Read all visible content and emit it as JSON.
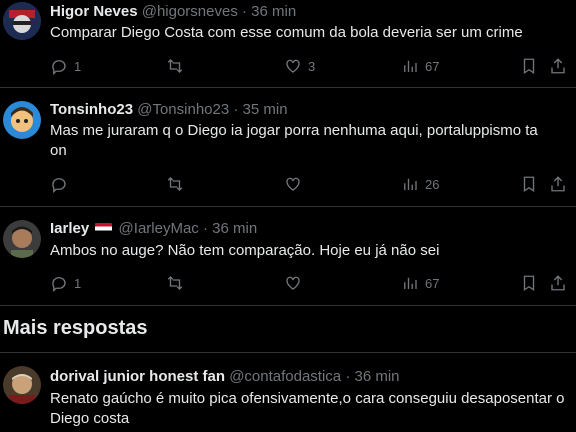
{
  "replies": [
    {
      "name": "Higor Neves",
      "handle": "@higorsneves",
      "time": "36 min",
      "text": "Comparar Diego Costa com esse comum da bola deveria ser um crime",
      "replies": "1",
      "retweets": "",
      "likes": "3",
      "views": "67"
    },
    {
      "name": "Tonsinho23",
      "handle": "@Tonsinho23",
      "time": "35 min",
      "text": "Mas me juraram q o Diego ia jogar porra nenhuma aqui, portaluppismo ta on",
      "replies": "",
      "retweets": "",
      "likes": "",
      "views": "26"
    },
    {
      "name": "Iarley",
      "handle": "@IarleyMac",
      "time": "36 min",
      "text": "Ambos no auge? Não tem comparação. Hoje eu já não sei",
      "replies": "1",
      "retweets": "",
      "likes": "",
      "views": "67"
    }
  ],
  "section_title": "Mais respostas",
  "more": {
    "name": "dorival junior honest fan",
    "handle": "@contafodastica",
    "time": "36 min",
    "text": "Renato gaúcho é muito pica ofensivamente,o cara conseguiu desaposentar o Diego costa"
  },
  "separator": "·",
  "icons": [
    "reply-icon",
    "retweet-icon",
    "like-icon",
    "views-icon",
    "bookmark-icon",
    "share-icon"
  ],
  "colors": {
    "background": "#000000",
    "text": "#e7e9ea",
    "muted": "#71767b",
    "border": "#2f3336"
  }
}
